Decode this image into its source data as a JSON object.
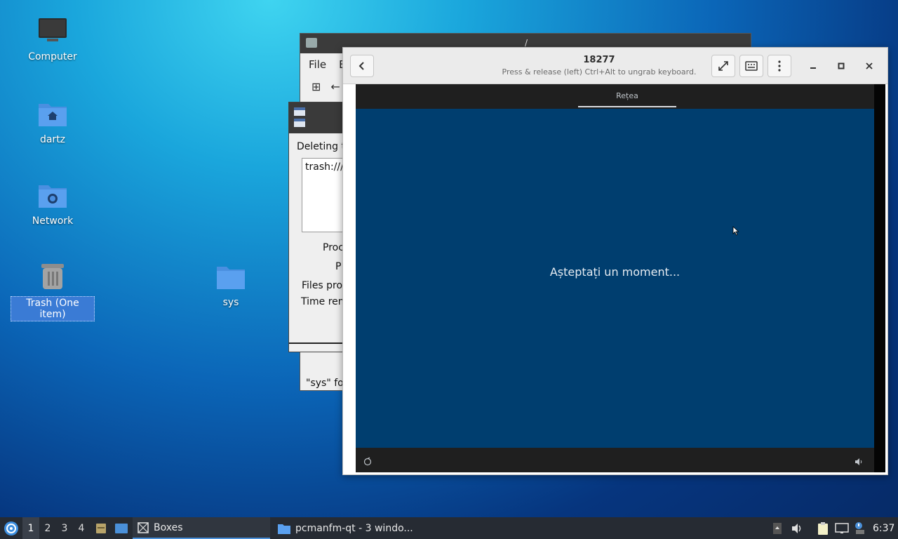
{
  "desktop": {
    "icons": [
      {
        "label": "Computer",
        "icon": "monitor-icon"
      },
      {
        "label": "dartz",
        "icon": "home-folder-icon"
      },
      {
        "label": "Network",
        "icon": "network-folder-icon"
      },
      {
        "label": "Trash (One item)",
        "icon": "trash-icon",
        "selected": true
      },
      {
        "label": "sys",
        "icon": "folder-icon"
      }
    ]
  },
  "file_manager": {
    "title": "/",
    "menu": [
      "File",
      "E"
    ],
    "status": "\"sys\" fol"
  },
  "delete_dialog": {
    "heading": "Deleting t",
    "item": "trash:///",
    "rows": [
      "Proc",
      "P",
      "Files pro",
      "Time rem"
    ]
  },
  "boxes": {
    "title": "18277",
    "subtitle": "Press & release (left) Ctrl+Alt to ungrab keyboard.",
    "vm": {
      "tab": "Rețea",
      "message": "Așteptați un moment..."
    }
  },
  "taskbar": {
    "workspaces": [
      "1",
      "2",
      "3",
      "4"
    ],
    "active_workspace": "1",
    "tasks": [
      {
        "label": "Boxes",
        "active": true
      },
      {
        "label": "pcmanfm-qt - 3 windo...",
        "active": false
      }
    ],
    "clock": "6:37"
  },
  "colors": {
    "vm_screen": "#003e6f",
    "taskbar": "#262b33",
    "selection": "#3a7bd5"
  }
}
